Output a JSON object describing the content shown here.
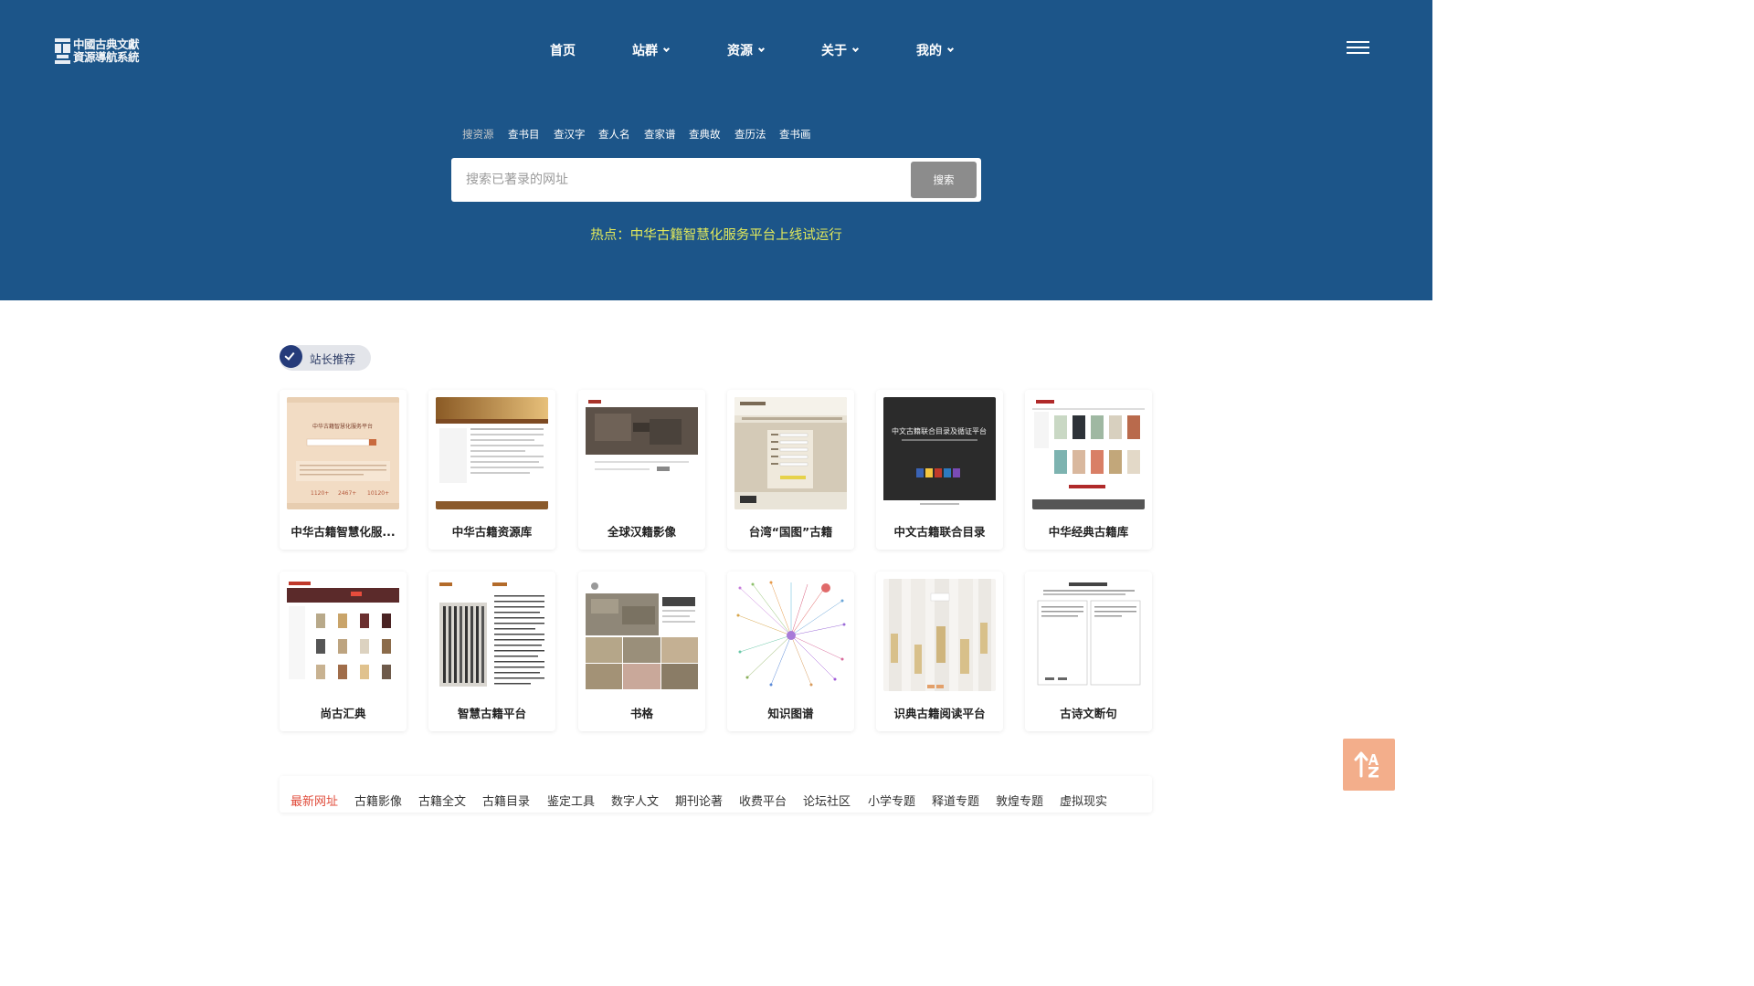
{
  "logo": {
    "line1": "中國古典文獻",
    "line2": "資源導航系統"
  },
  "nav": [
    {
      "label": "首页",
      "has_dropdown": false
    },
    {
      "label": "站群",
      "has_dropdown": true
    },
    {
      "label": "资源",
      "has_dropdown": true
    },
    {
      "label": "关于",
      "has_dropdown": true
    },
    {
      "label": "我的",
      "has_dropdown": true
    }
  ],
  "menu_icon": "hamburger-icon",
  "search": {
    "tabs": [
      "搜资源",
      "查书目",
      "查汉字",
      "查人名",
      "查家谱",
      "查典故",
      "查历法",
      "查书画"
    ],
    "active_tab": "搜资源",
    "placeholder": "搜索已著录的网址",
    "button": "搜索"
  },
  "hot": "热点：中华古籍智慧化服务平台上线试运行",
  "recommend": {
    "badge": "站长推荐",
    "cards": [
      {
        "title": "中华古籍智慧化服...",
        "thumb": "parchment"
      },
      {
        "title": "中华古籍资源库",
        "thumb": "goldbanner"
      },
      {
        "title": "全球汉籍影像",
        "thumb": "darkmap"
      },
      {
        "title": "台湾“国图”古籍",
        "thumb": "beigeform"
      },
      {
        "title": "中文古籍联合目录",
        "thumb": "darkcatalog"
      },
      {
        "title": "中华经典古籍库",
        "thumb": "bookgrid"
      },
      {
        "title": "尚古汇典",
        "thumb": "booklist"
      },
      {
        "title": "智慧古籍平台",
        "thumb": "scan"
      },
      {
        "title": "书格",
        "thumb": "paintings"
      },
      {
        "title": "知识图谱",
        "thumb": "graph"
      },
      {
        "title": "识典古籍阅读平台",
        "thumb": "scrolls"
      },
      {
        "title": "古诗文断句",
        "thumb": "textdoc"
      }
    ]
  },
  "categories": [
    "最新网址",
    "古籍影像",
    "古籍全文",
    "古籍目录",
    "鉴定工具",
    "数字人文",
    "期刊论著",
    "收费平台",
    "论坛社区",
    "小学专题",
    "释道专题",
    "敦煌专题",
    "虚拟现实"
  ],
  "active_category": "最新网址",
  "back_to_top_icon": "sort-az-icon",
  "colors": {
    "hero_bg": "#1c5589",
    "hot_text": "#e1e85b",
    "active_category": "#e04b3a",
    "back_to_top": "#f3ae8b"
  }
}
